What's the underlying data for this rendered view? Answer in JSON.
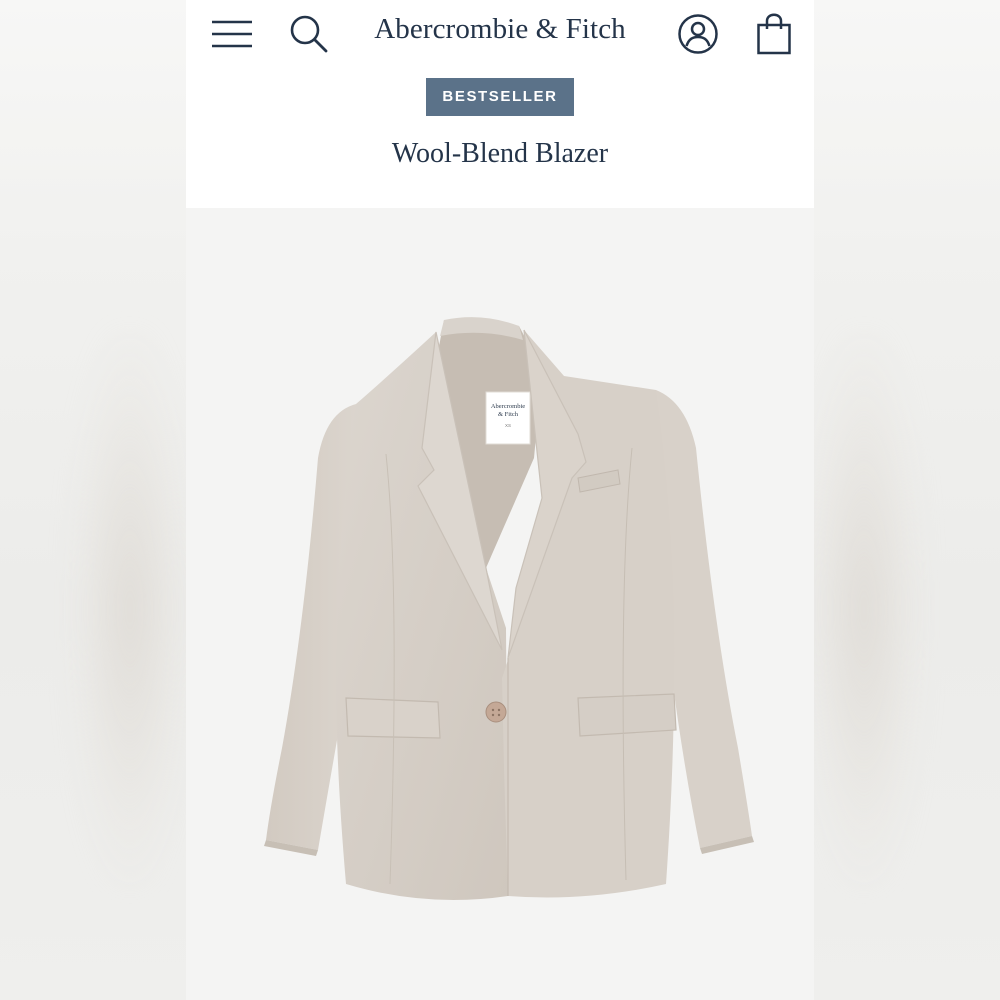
{
  "header": {
    "brand": "Abercrombie & Fitch",
    "icons": [
      "menu-icon",
      "search-icon",
      "account-icon",
      "shopping-bag-icon"
    ]
  },
  "product": {
    "badge": "BESTSELLER",
    "title": "Wool-Blend Blazer",
    "image_subject": "beige single-button wool-blend blazer",
    "label_text": "Abercrombie & Fitch"
  },
  "colors": {
    "brand_navy": "#243449",
    "badge_bg": "#5b7289",
    "blazer": "#d6cfc7",
    "lining": "#c8bfb6"
  }
}
